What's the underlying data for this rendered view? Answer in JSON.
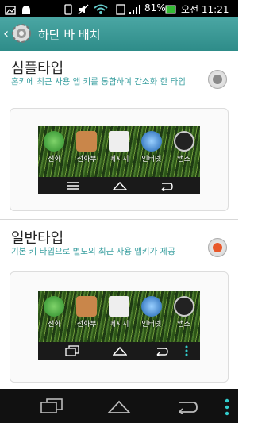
{
  "status_bar": {
    "battery": "81%",
    "time": "오전 11:21"
  },
  "action_bar": {
    "title": "하단 바 배치"
  },
  "options": [
    {
      "title": "심플타입",
      "description": "홈키에 최근 사용 앱 키를 통합하여 간소화 한 타입",
      "selected": false
    },
    {
      "title": "일반타입",
      "description": "기본 키 타입으로 별도의 최근 사용 앱키가 제공",
      "selected": true
    }
  ],
  "preview_apps": [
    "전화",
    "전화부",
    "메시지",
    "인터넷",
    "앱스"
  ],
  "colors": {
    "accent": "#3a9fa0",
    "action_bar": "#2e8c89",
    "radio_selected": "#e8582a"
  }
}
